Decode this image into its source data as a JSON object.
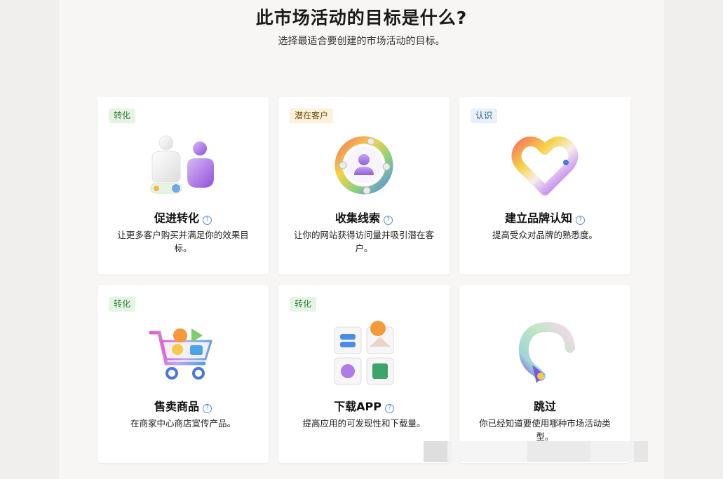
{
  "header": {
    "title": "此市场活动的目标是什么?",
    "subtitle": "选择最适合要创建的市场活动的目标。"
  },
  "cards": [
    {
      "badge": "转化",
      "badge_color": "green",
      "icon": "conversion-icon",
      "title": "促进转化",
      "description": "让更多客户购买并满足你的效果目标。"
    },
    {
      "badge": "潜在客户",
      "badge_color": "yellow",
      "icon": "lead-collection-icon",
      "title": "收集线索",
      "description": "让你的网站获得访问量并吸引潜在客户。"
    },
    {
      "badge": "认识",
      "badge_color": "blue",
      "icon": "heart-icon",
      "title": "建立品牌认知",
      "description": "提高受众对品牌的熟悉度。"
    },
    {
      "badge": "转化",
      "badge_color": "green",
      "icon": "shopping-cart-icon",
      "title": "售卖商品",
      "description": "在商家中心商店宣传产品。"
    },
    {
      "badge": "转化",
      "badge_color": "green",
      "icon": "app-download-icon",
      "title": "下载APP",
      "description": "提高应用的可发现性和下载量。"
    },
    {
      "badge": "",
      "badge_color": "",
      "icon": "skip-arrow-icon",
      "title": "跳过",
      "description": "你已经知道要使用哪种市场活动类型。"
    }
  ]
}
